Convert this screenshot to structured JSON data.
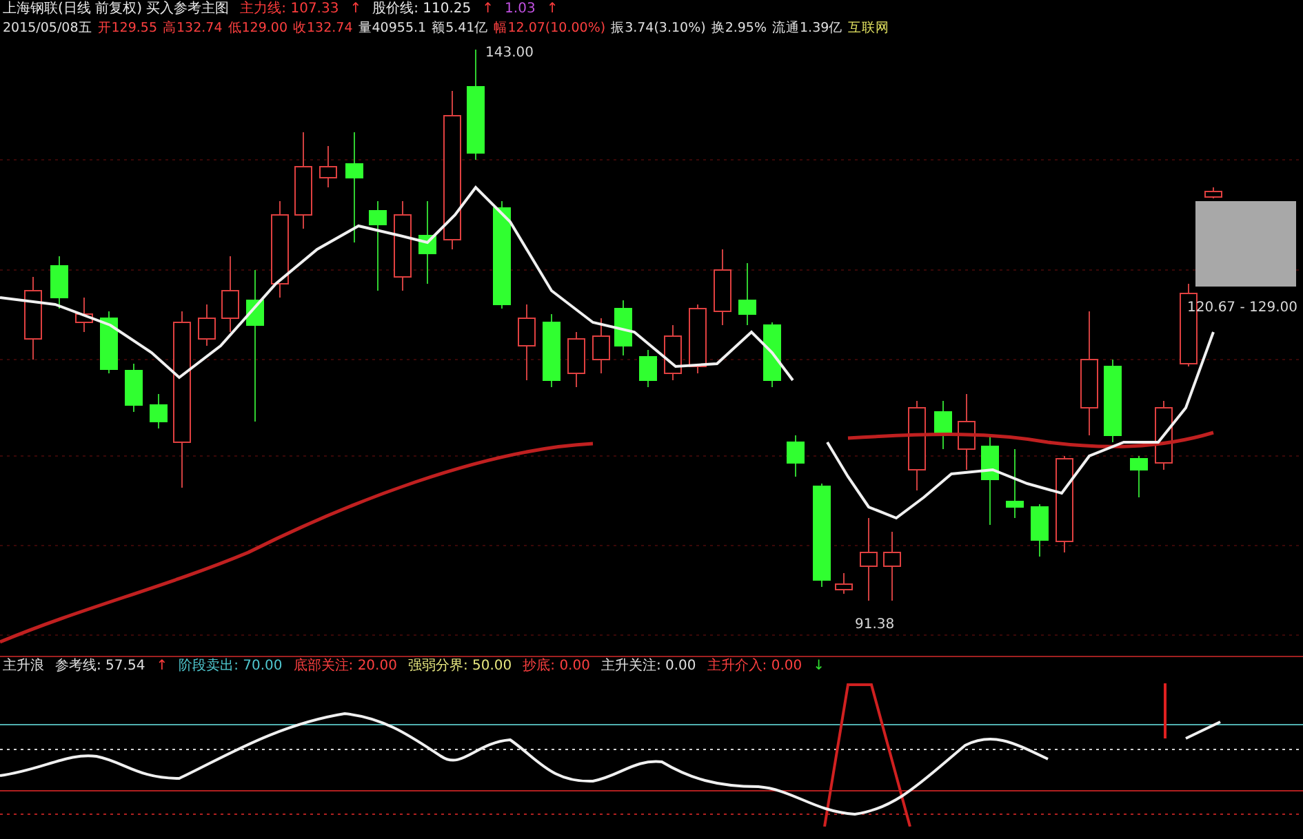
{
  "header": {
    "title": "上海钢联(日线 前复权) 买入参考主图",
    "indicators": [
      {
        "text": "主力线: 107.33",
        "color": "#ff3c3c"
      },
      {
        "text": "↑",
        "color": "#ff3c3c"
      },
      {
        "text": "股价线: 110.25",
        "color": "#e8e8e8"
      },
      {
        "text": "↑",
        "color": "#ff3c3c"
      },
      {
        "text": "1.03",
        "color": "#c050e0"
      },
      {
        "text": "↑",
        "color": "#ff3c3c"
      }
    ],
    "quote": [
      {
        "text": "2015/05/08五",
        "color": "#e0e0e0"
      },
      {
        "text": "开129.55",
        "color": "#ff4040"
      },
      {
        "text": "高132.74",
        "color": "#ff4040"
      },
      {
        "text": "低129.00",
        "color": "#ff4040"
      },
      {
        "text": "收132.74",
        "color": "#ff4040"
      },
      {
        "text": "量40955.1",
        "color": "#e0e0e0"
      },
      {
        "text": "额5.41亿",
        "color": "#e0e0e0"
      },
      {
        "text": "幅12.07(10.00%)",
        "color": "#ff4040"
      },
      {
        "text": "振3.74(3.10%)",
        "color": "#e0e0e0"
      },
      {
        "text": "换2.95%",
        "color": "#e0e0e0"
      },
      {
        "text": "流通1.39亿",
        "color": "#e0e0e0"
      },
      {
        "text": "互联网",
        "color": "#e0e060"
      }
    ]
  },
  "chart": {
    "high_label": "143.00",
    "low_label": "91.38",
    "range_label": "120.67 - 129.00"
  },
  "indicator": {
    "items": [
      {
        "text": "主升浪",
        "color": "#e0e0e0"
      },
      {
        "text": "参考线: 57.54",
        "color": "#e0e0e0"
      },
      {
        "text": "↑",
        "color": "#ff3c3c"
      },
      {
        "text": "阶段卖出: 70.00",
        "color": "#50c8d0"
      },
      {
        "text": "底部关注: 20.00",
        "color": "#ff4040"
      },
      {
        "text": "强弱分界: 50.00",
        "color": "#e8e880"
      },
      {
        "text": "抄底: 0.00",
        "color": "#ff4040"
      },
      {
        "text": "主升关注: 0.00",
        "color": "#e0e0e0"
      },
      {
        "text": "主升介入: 0.00",
        "color": "#ff4040"
      },
      {
        "text": "↓",
        "color": "#30e030"
      }
    ]
  }
}
